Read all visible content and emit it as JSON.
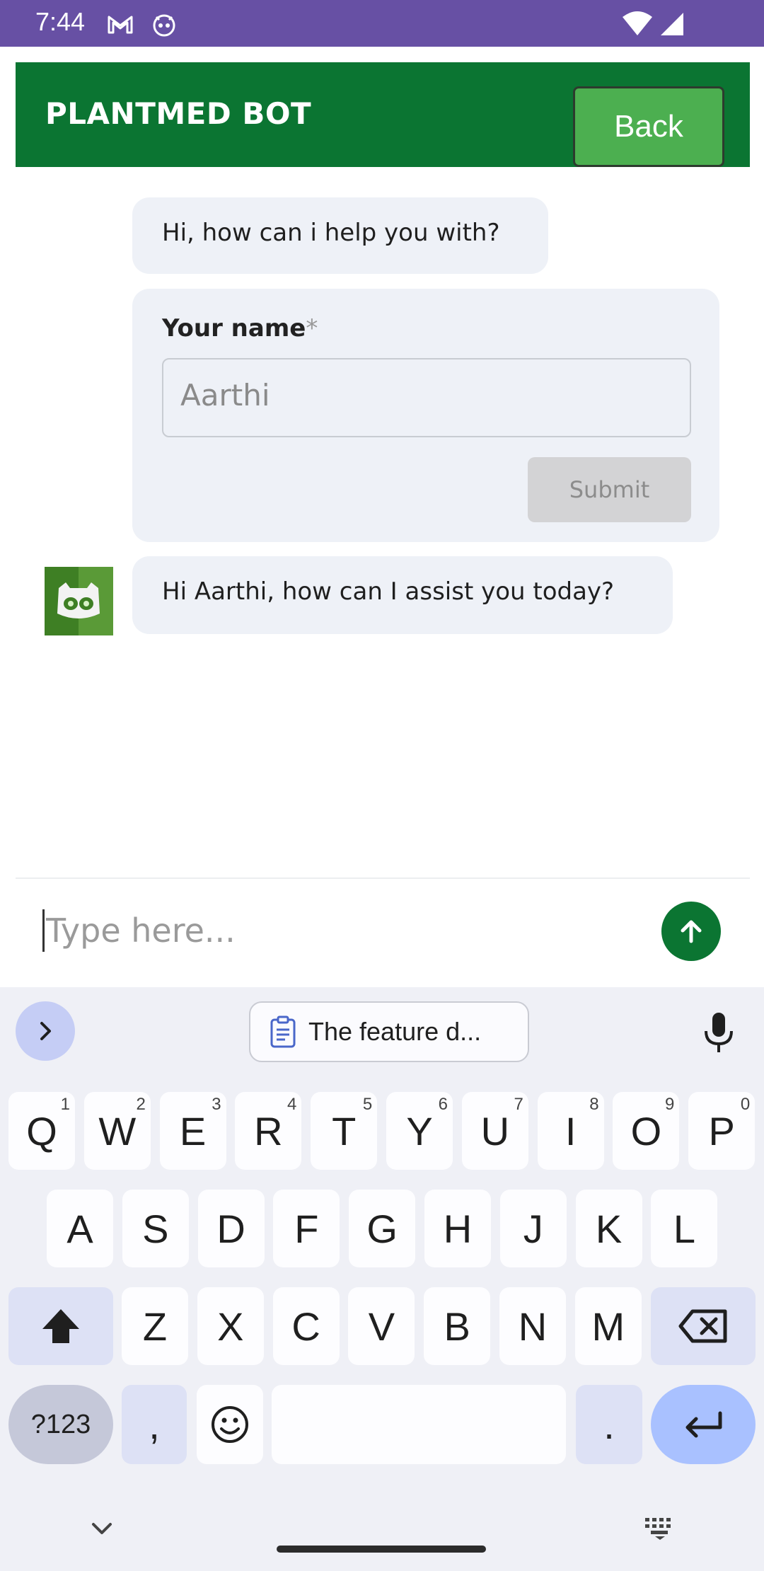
{
  "status_bar": {
    "time": "7:44",
    "icons": [
      "gmail-icon",
      "notification-icon",
      "wifi-icon",
      "signal-icon"
    ]
  },
  "header": {
    "title": "PLANTMED BOT",
    "back_label": "Back",
    "color": "#0b7532",
    "back_color": "#4caf50"
  },
  "chat": {
    "greeting": "Hi, how can i help you with?",
    "form": {
      "label": "Your name",
      "required_mark": "*",
      "input_value": "Aarthi",
      "submit_label": "Submit"
    },
    "reply": "Hi Aarthi, how can I assist you today?"
  },
  "composer": {
    "placeholder": "Type here..."
  },
  "keyboard": {
    "clipboard_text": "The feature d...",
    "row1": [
      {
        "k": "Q",
        "h": "1"
      },
      {
        "k": "W",
        "h": "2"
      },
      {
        "k": "E",
        "h": "3"
      },
      {
        "k": "R",
        "h": "4"
      },
      {
        "k": "T",
        "h": "5"
      },
      {
        "k": "Y",
        "h": "6"
      },
      {
        "k": "U",
        "h": "7"
      },
      {
        "k": "I",
        "h": "8"
      },
      {
        "k": "O",
        "h": "9"
      },
      {
        "k": "P",
        "h": "0"
      }
    ],
    "row2": [
      "A",
      "S",
      "D",
      "F",
      "G",
      "H",
      "J",
      "K",
      "L"
    ],
    "row3": [
      "Z",
      "X",
      "C",
      "V",
      "B",
      "N",
      "M"
    ],
    "symbols_label": "?123",
    "comma": ",",
    "period": "."
  }
}
